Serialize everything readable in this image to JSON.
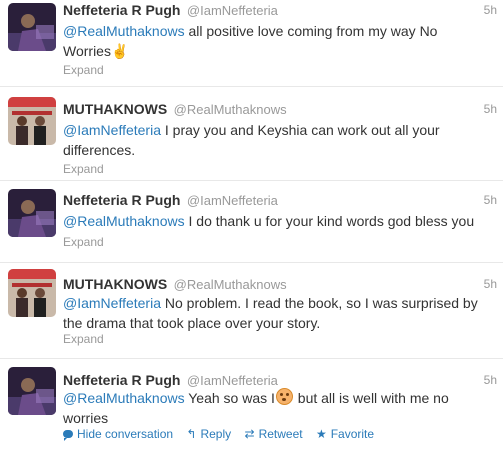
{
  "tweets": [
    {
      "fullname": "Neffeteria R Pugh",
      "username": "@IamNeffeteria",
      "time": "5h",
      "mention": "@RealMuthaknows",
      "text_line1": " all positive love coming from my way No",
      "text_line2": "Worries",
      "emoji": "✌",
      "expand": "Expand"
    },
    {
      "fullname": "MUTHAKNOWS",
      "username": "@RealMuthaknows",
      "time": "5h",
      "mention": "@IamNeffeteria",
      "text_line1": " I pray you and Keyshia can work out all your",
      "text_line2": "differences.",
      "expand": "Expand"
    },
    {
      "fullname": "Neffeteria R Pugh",
      "username": "@IamNeffeteria",
      "time": "5h",
      "mention": "@RealMuthaknows",
      "text_line1": " I do thank u for your kind words god bless you",
      "expand": "Expand"
    },
    {
      "fullname": "MUTHAKNOWS",
      "username": "@RealMuthaknows",
      "time": "5h",
      "mention": "@IamNeffeteria",
      "text_line1": " No problem. I read the book, so I was surprised by",
      "text_line2": "the drama that took place over your story.",
      "expand": "Expand"
    },
    {
      "fullname": "Neffeteria R Pugh",
      "username": "@IamNeffeteria",
      "time": "5h",
      "mention": "@RealMuthaknows",
      "text_line1a": " Yeah so was I",
      "text_line1b": " but all is well with me no",
      "text_line2": "worries"
    }
  ],
  "actions": {
    "hide_conversation": "Hide conversation",
    "reply": "Reply",
    "retweet": "Retweet",
    "favorite": "Favorite"
  },
  "icons": {
    "reply": "reply-arrow-icon",
    "retweet": "retweet-icon",
    "favorite": "star-icon",
    "conversation": "speech-bubble-icon"
  },
  "colors": {
    "link": "#2b7bb9",
    "muted": "#999999",
    "text": "#333333",
    "divider": "#e8e8e8"
  }
}
